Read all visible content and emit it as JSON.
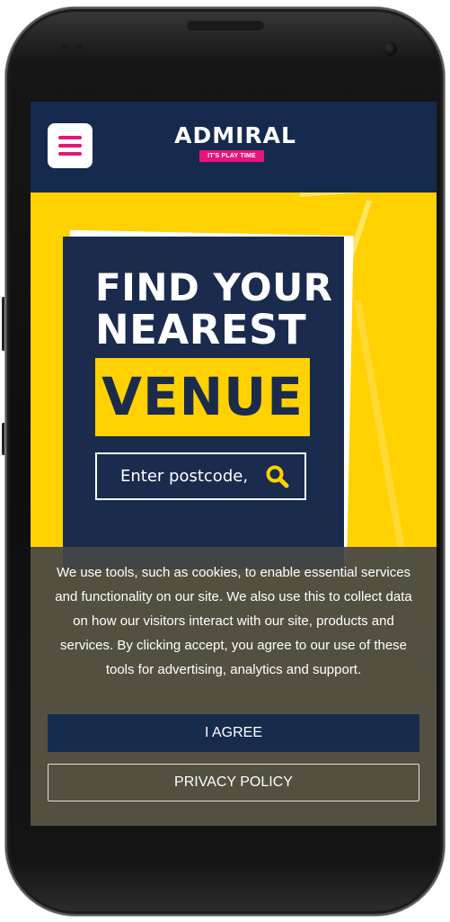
{
  "brand": {
    "name": "ADMIRAL",
    "tagline": "IT'S PLAY TIME",
    "accent_pink": "#e6157a",
    "navy": "#162a4e",
    "yellow": "#ffd100"
  },
  "header": {
    "menu_icon": "hamburger-menu-icon"
  },
  "hero": {
    "line1": "FIND YOUR",
    "line2": "NEAREST",
    "highlight": "VENUE",
    "search": {
      "placeholder": "Enter postcode,",
      "icon": "search-icon"
    }
  },
  "cookie_banner": {
    "message": "We use tools, such as cookies, to enable essential services and functionality on our site. We also use this to collect data on how our visitors interact with our site, products and services. By clicking accept, you agree to our use of these tools for advertising, analytics and support.",
    "agree_label": "I AGREE",
    "privacy_label": "PRIVACY POLICY"
  }
}
